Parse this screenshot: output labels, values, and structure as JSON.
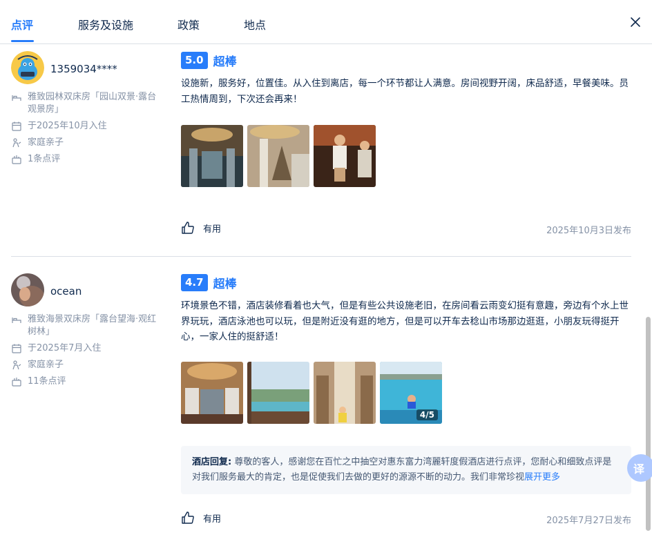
{
  "tabs": [
    {
      "label": "点评",
      "active": true
    },
    {
      "label": "服务及设施",
      "active": false
    },
    {
      "label": "政策",
      "active": false
    },
    {
      "label": "地点",
      "active": false
    }
  ],
  "colors": {
    "accent": "#287dfa",
    "text": "#0f294d",
    "muted": "#8592a6"
  },
  "reviews": [
    {
      "username": "1359034****",
      "room": "雅致园林双床房「园山双景·露台观景房」",
      "checkin": "于2025年10月入住",
      "trip_type": "家庭亲子",
      "review_count": "1条点评",
      "score": "5.0",
      "score_word": "超棒",
      "content": "设施新，服务好，位置佳。从入住到离店，每一个环节都让人满意。房间视野开阔，床品舒适，早餐美味。员工热情周到，下次还会再来！",
      "useful_label": "有用",
      "date": "2025年10月3日发布"
    },
    {
      "username": "ocean",
      "room": "雅致海景双床房「露台望海·观红树林」",
      "checkin": "于2025年7月入住",
      "trip_type": "家庭亲子",
      "review_count": "11条点评",
      "score": "4.7",
      "score_word": "超棒",
      "content": "环境景色不错，酒店装修看着也大气，但是有些公共设施老旧，在房间看云雨变幻挺有意趣，旁边有个水上世界玩玩，酒店泳池也可以玩，但是附近没有逛的地方，但是可以开车去稔山市场那边逛逛，小朋友玩得挺开心，一家人住的挺舒适！",
      "photo_count": "4/5",
      "reply_label": "酒店回复:",
      "reply_text": " 尊敬的客人，感谢您在百忙之中抽空对惠东富力湾麗轩度假酒店进行点评，您耐心和细致点评是对我们服务最大的肯定，也是促使我们去做的更好的源源不断的动力。我们非常珍视",
      "reply_more": "展开更多",
      "useful_label": "有用",
      "date": "2025年7月27日发布"
    }
  ],
  "translate_label": "译"
}
